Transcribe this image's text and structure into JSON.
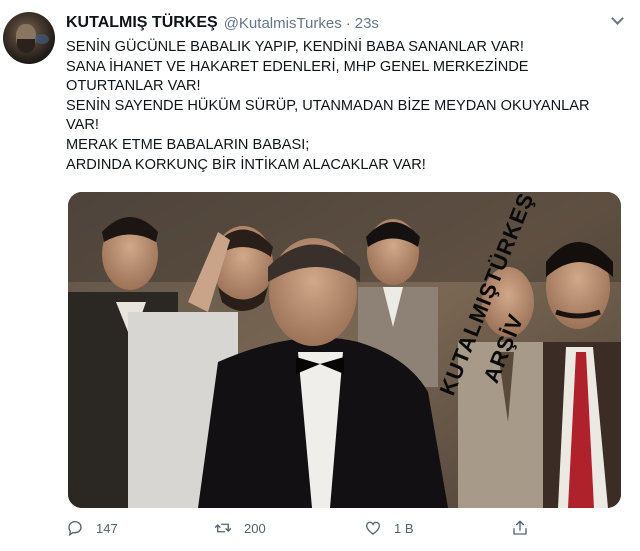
{
  "tweet": {
    "author_name": "KUTALMIŞ TÜRKEŞ",
    "handle": "@KutalmisTurkes",
    "separator": "·",
    "time": "23s",
    "lines": [
      "SENİN GÜCÜNLE BABALIK YAPIP, KENDİNİ BABA SANANLAR VAR!",
      "SANA İHANET VE HAKARET EDENLERİ, MHP GENEL MERKEZİNDE",
      "OTURTANLAR VAR!",
      "SENİN SAYENDE HÜKÜM SÜRÜP, UTANMADAN BİZE MEYDAN OKUYANLAR",
      "VAR!",
      "MERAK ETME BABALARIN BABASI;",
      "ARDINDA KORKUNÇ BİR İNTİKAM ALACAKLAR VAR!"
    ],
    "watermark": [
      "KUTALMIŞTÜRKEŞ",
      "ARŞİV"
    ]
  },
  "actions": {
    "reply_count": "147",
    "retweet_count": "200",
    "like_count": "1 B"
  },
  "colors": {
    "text": "#0f1419",
    "secondary": "#657786",
    "icon": "#536471"
  },
  "icons": [
    "reply-icon",
    "retweet-icon",
    "like-icon",
    "share-icon",
    "more-chevron-icon"
  ]
}
